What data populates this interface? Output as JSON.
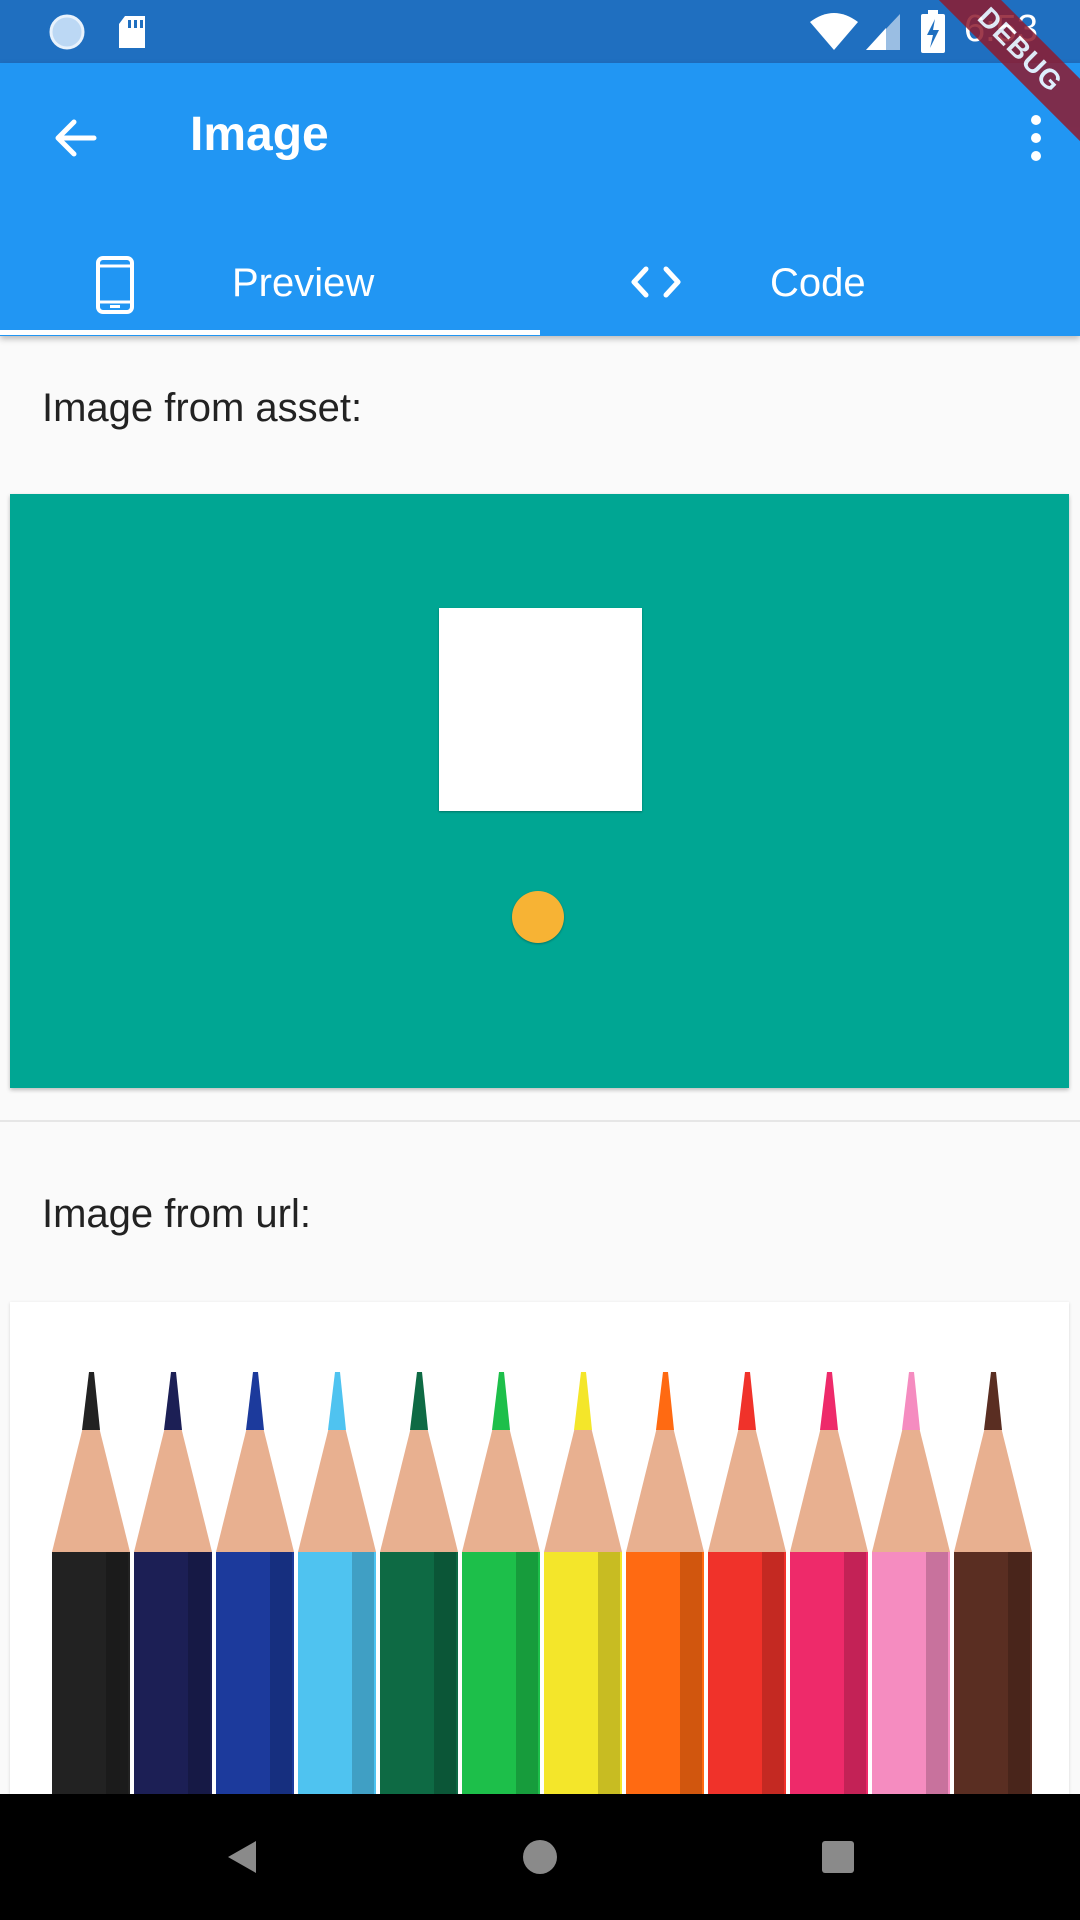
{
  "status_bar": {
    "time": "6:53",
    "icons": [
      "sync-icon",
      "sd-card-icon",
      "wifi-icon",
      "signal-icon",
      "battery-charging-icon"
    ]
  },
  "app_bar": {
    "title": "Image",
    "back_icon": "arrow-back-icon",
    "menu_icon": "more-vert-icon",
    "debug_banner": "DEBUG",
    "tabs": [
      {
        "label": "Preview",
        "icon": "phone-icon",
        "selected": true
      },
      {
        "label": "Code",
        "icon": "code-icon",
        "selected": false
      }
    ]
  },
  "content": {
    "asset_label": "Image from asset:",
    "url_label": "Image from url:",
    "asset_image": {
      "background": "#00a693",
      "square_color": "#ffffff",
      "dot_color": "#f7b334"
    },
    "url_image": {
      "pencil_colors": [
        "#222222",
        "#1c1f55",
        "#1c3a9c",
        "#4fc3f0",
        "#0e6a44",
        "#1dbf4a",
        "#f4e62a",
        "#ff6a12",
        "#f0322a",
        "#ee2a6a",
        "#f58cc0",
        "#5a2e22"
      ]
    }
  },
  "nav_bar": {
    "icons": [
      "back-triangle-icon",
      "home-circle-icon",
      "recents-square-icon"
    ]
  },
  "colors": {
    "primary": "#2196f3",
    "status_bar": "#1f6fc0",
    "background": "#fafafa"
  }
}
